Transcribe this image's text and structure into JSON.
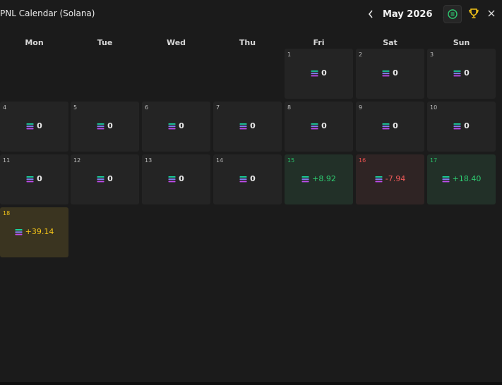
{
  "header": {
    "title": "PNL Calendar (Solana)",
    "month_label": "May 2026"
  },
  "weekdays": [
    "Mon",
    "Tue",
    "Wed",
    "Thu",
    "Fri",
    "Sat",
    "Sun"
  ],
  "days": [
    {
      "day": "1",
      "value": "0",
      "state": "neutral"
    },
    {
      "day": "2",
      "value": "0",
      "state": "neutral"
    },
    {
      "day": "3",
      "value": "0",
      "state": "neutral"
    },
    {
      "day": "4",
      "value": "0",
      "state": "neutral"
    },
    {
      "day": "5",
      "value": "0",
      "state": "neutral"
    },
    {
      "day": "6",
      "value": "0",
      "state": "neutral"
    },
    {
      "day": "7",
      "value": "0",
      "state": "neutral"
    },
    {
      "day": "8",
      "value": "0",
      "state": "neutral"
    },
    {
      "day": "9",
      "value": "0",
      "state": "neutral"
    },
    {
      "day": "10",
      "value": "0",
      "state": "neutral"
    },
    {
      "day": "11",
      "value": "0",
      "state": "neutral"
    },
    {
      "day": "12",
      "value": "0",
      "state": "neutral"
    },
    {
      "day": "13",
      "value": "0",
      "state": "neutral"
    },
    {
      "day": "14",
      "value": "0",
      "state": "neutral"
    },
    {
      "day": "15",
      "value": "+8.92",
      "state": "positive"
    },
    {
      "day": "16",
      "value": "-7.94",
      "state": "negative"
    },
    {
      "day": "17",
      "value": "+18.40",
      "state": "positive"
    },
    {
      "day": "18",
      "value": "+39.14",
      "state": "today"
    }
  ],
  "colors": {
    "positive": "#2ecc71",
    "negative": "#ee5a59",
    "today": "#f5c518",
    "background": "#1b1b1b"
  },
  "icons": [
    "chevron-left-icon",
    "chevron-right-icon",
    "solana-icon",
    "trophy-icon",
    "close-icon"
  ]
}
